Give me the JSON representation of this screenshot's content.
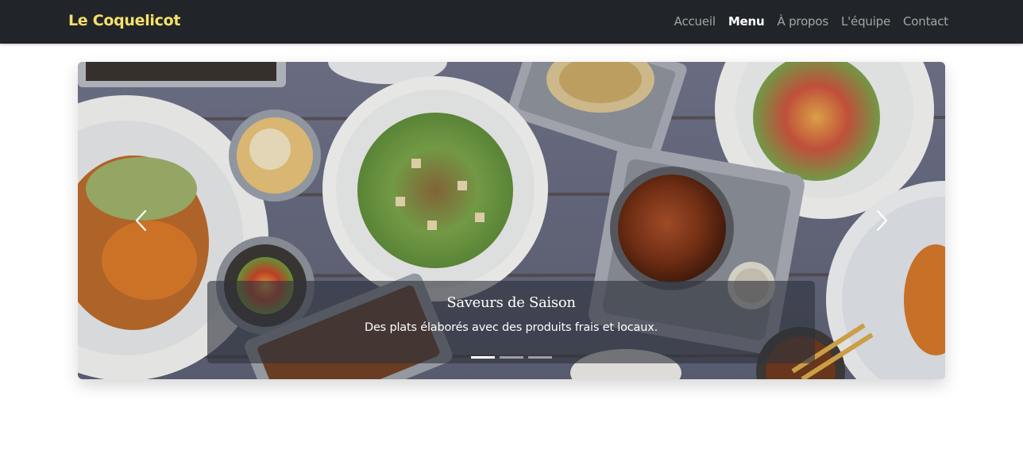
{
  "brand": {
    "name": "Le Coquelicot"
  },
  "nav": {
    "items": [
      {
        "label": "Accueil",
        "active": false
      },
      {
        "label": "Menu",
        "active": true
      },
      {
        "label": "À propos",
        "active": false
      },
      {
        "label": "L'équipe",
        "active": false
      },
      {
        "label": "Contact",
        "active": false
      }
    ]
  },
  "carousel": {
    "active_slide": 1,
    "slide_count": 3,
    "caption": {
      "title": "Saveurs de Saison",
      "text": "Des plats élaborés avec des produits frais et locaux."
    }
  },
  "colors": {
    "navbar_bg": "#212529",
    "brand": "#f7e06b",
    "nav_link": "#9a9c9f",
    "nav_active": "#ffffff",
    "table_wood": "#6b6e82"
  },
  "icons": {
    "prev": "chevron-left-icon",
    "next": "chevron-right-icon"
  }
}
